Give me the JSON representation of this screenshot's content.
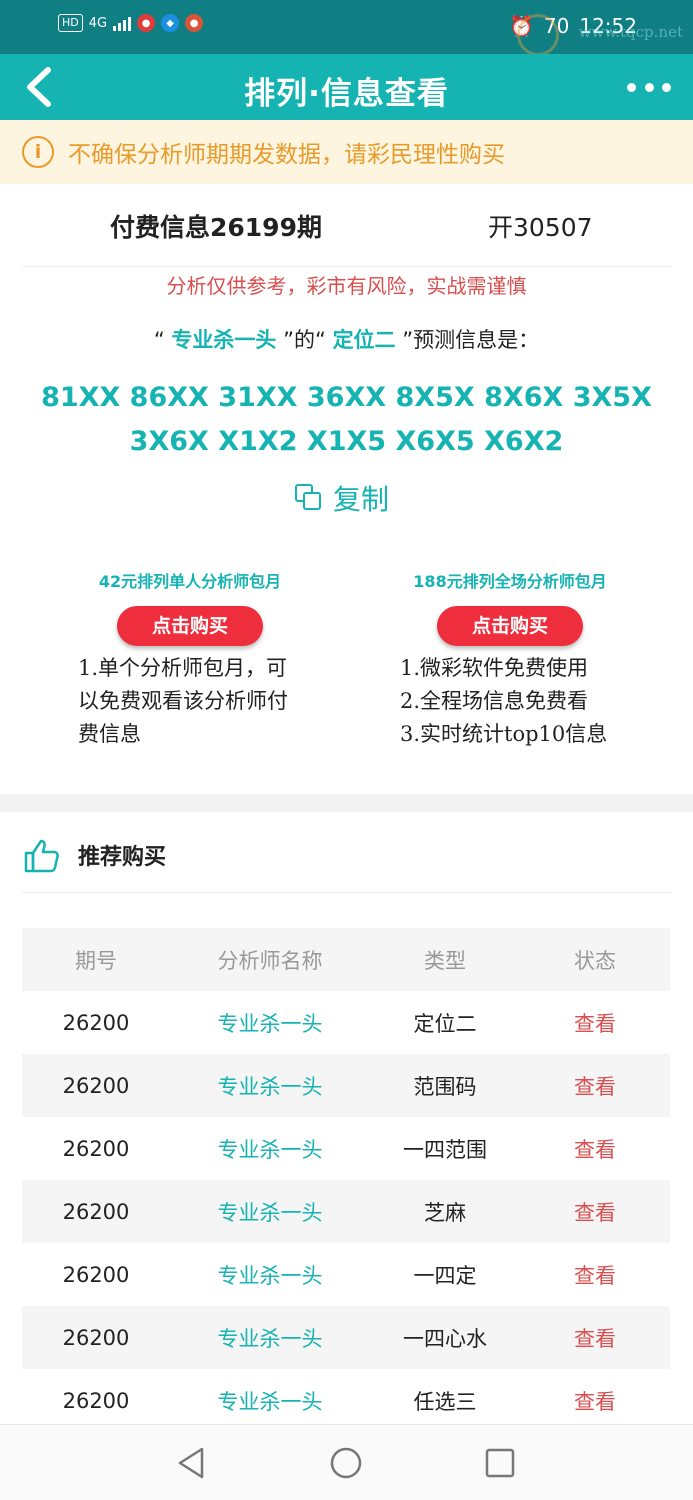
{
  "status_bar": {
    "hd": "HD",
    "net": "4G",
    "time": "12:52",
    "battery": "70",
    "watermark": "www.tqcp.net"
  },
  "navbar": {
    "title": "排列·信息查看"
  },
  "notice": {
    "text": "不确保分析师期期发数据，请彩民理性购买"
  },
  "info": {
    "issue_title": "付费信息26199期",
    "open_label": "开30507",
    "risk_text": "分析仅供参考，彩市有风险，实战需谨慎",
    "predict_open_quote": "“",
    "predict_analyst": "专业杀一头",
    "predict_mid": "”的“",
    "predict_type": "定位二",
    "predict_tail": "”预测信息是：",
    "numbers": "81XX 86XX 31XX 36XX 8X5X 8X6X 3X5X 3X6X X1X2 X1X5 X6X5 X6X2",
    "copy_label": "复制"
  },
  "plans": [
    {
      "title": "42元排列单人分析师包月",
      "button": "点击购买",
      "desc": "1.单个分析师包月，可以免费观看该分析师付费信息"
    },
    {
      "title": "188元排列全场分析师包月",
      "button": "点击购买",
      "desc_lines": [
        "1.微彩软件免费使用",
        "2.全程场信息免费看",
        "3.实时统计top10信息"
      ]
    }
  ],
  "recommend": {
    "title": "推荐购买",
    "headers": [
      "期号",
      "分析师名称",
      "类型",
      "状态"
    ],
    "rows": [
      {
        "issue": "26200",
        "analyst": "专业杀一头",
        "type": "定位二",
        "status": "查看"
      },
      {
        "issue": "26200",
        "analyst": "专业杀一头",
        "type": "范围码",
        "status": "查看"
      },
      {
        "issue": "26200",
        "analyst": "专业杀一头",
        "type": "一四范围",
        "status": "查看"
      },
      {
        "issue": "26200",
        "analyst": "专业杀一头",
        "type": "芝麻",
        "status": "查看"
      },
      {
        "issue": "26200",
        "analyst": "专业杀一头",
        "type": "一四定",
        "status": "查看"
      },
      {
        "issue": "26200",
        "analyst": "专业杀一头",
        "type": "一四心水",
        "status": "查看"
      },
      {
        "issue": "26200",
        "analyst": "专业杀一头",
        "type": "任选三",
        "status": "查看"
      }
    ]
  },
  "colors": {
    "brand": "#15b3b2",
    "status_bar": "#0f7f84",
    "warning": "#e89b2b",
    "danger": "#d94f4f",
    "buy_button": "#ee2e3d"
  }
}
